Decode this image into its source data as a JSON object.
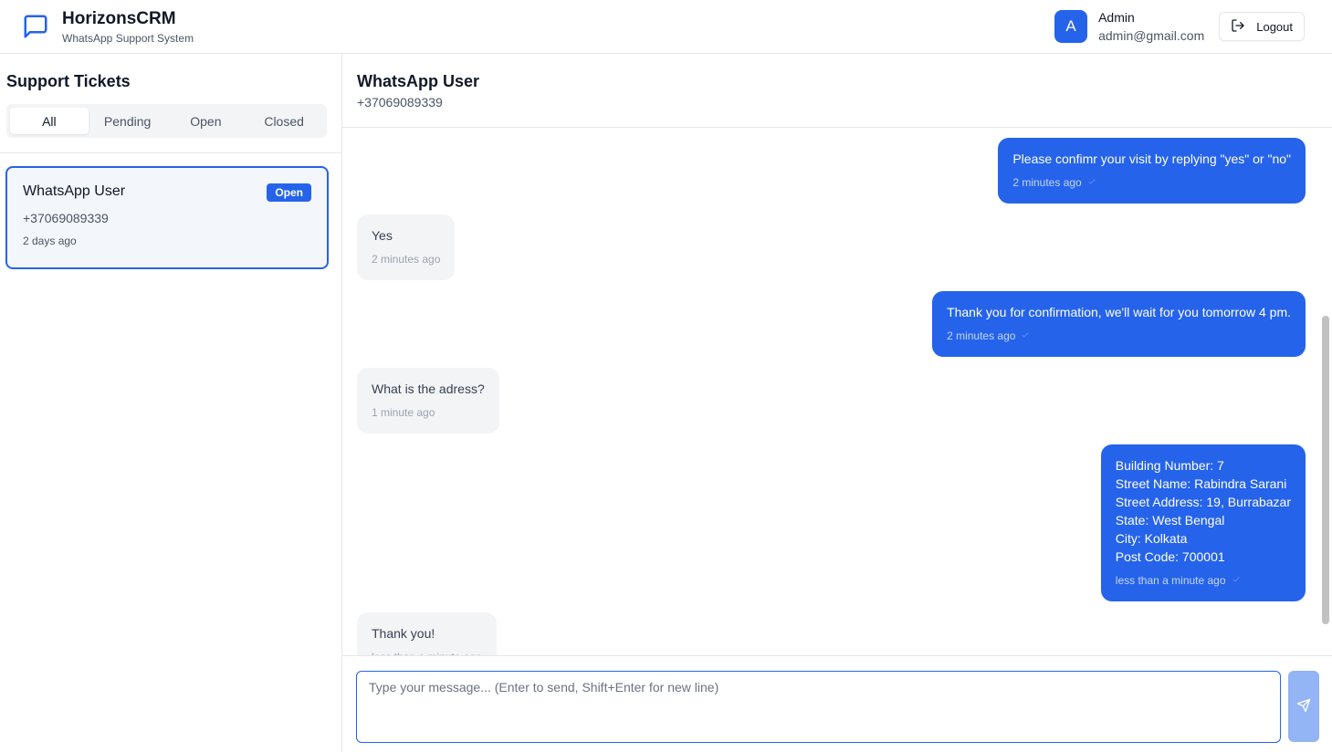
{
  "header": {
    "app_title": "HorizonsCRM",
    "app_subtitle": "WhatsApp Support System",
    "user_initial": "A",
    "user_name": "Admin",
    "user_email": "admin@gmail.com",
    "logout_label": "Logout"
  },
  "sidebar": {
    "title": "Support Tickets",
    "tabs": [
      {
        "label": "All",
        "active": true
      },
      {
        "label": "Pending",
        "active": false
      },
      {
        "label": "Open",
        "active": false
      },
      {
        "label": "Closed",
        "active": false
      }
    ],
    "tickets": [
      {
        "name": "WhatsApp User",
        "status": "Open",
        "phone": "+37069089339",
        "time": "2 days ago"
      }
    ]
  },
  "chat": {
    "contact_name": "WhatsApp User",
    "contact_phone": "+37069089339",
    "messages": [
      {
        "direction": "out",
        "lines": [
          "Please confimr your visit by replying \"yes\" or \"no\""
        ],
        "time": "2 minutes ago"
      },
      {
        "direction": "in",
        "lines": [
          "Yes"
        ],
        "time": "2 minutes ago"
      },
      {
        "direction": "out",
        "lines": [
          "Thank you for confirmation, we'll wait for you tomorrow 4 pm."
        ],
        "time": "2 minutes ago"
      },
      {
        "direction": "in",
        "lines": [
          "What is the adress?"
        ],
        "time": "1 minute ago"
      },
      {
        "direction": "out",
        "lines": [
          "Building Number: 7",
          "Street Name: Rabindra Sarani",
          "Street Address: 19, Burrabazar",
          "State: West Bengal",
          "City: Kolkata",
          "Post Code: 700001"
        ],
        "time": "less than a minute ago"
      },
      {
        "direction": "in",
        "lines": [
          "Thank you!"
        ],
        "time": "less than a minute ago"
      }
    ],
    "composer_placeholder": "Type your message... (Enter to send, Shift+Enter for new line)"
  },
  "colors": {
    "accent": "#2563eb",
    "send_button": "#93b4f5"
  }
}
